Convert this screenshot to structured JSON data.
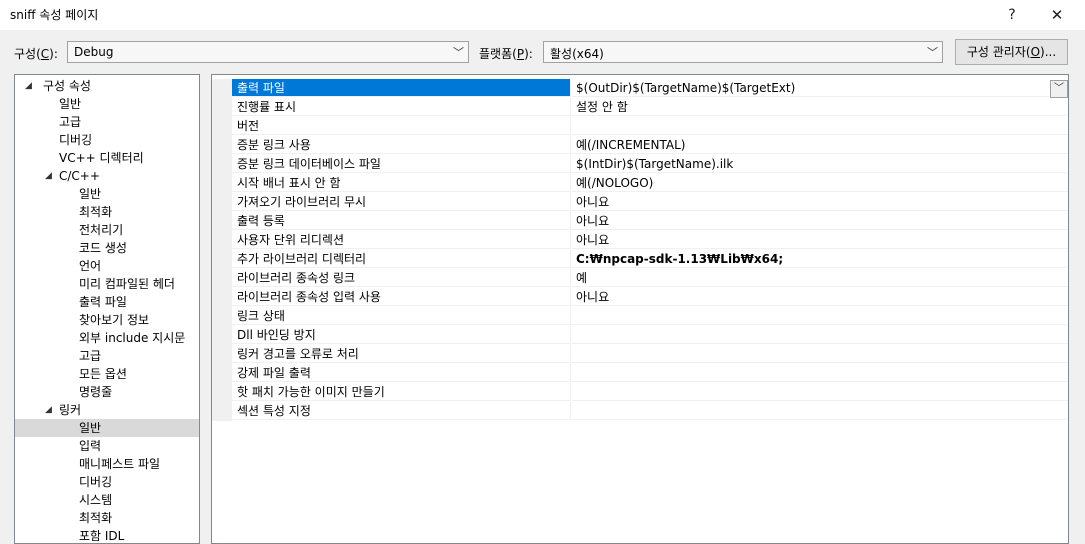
{
  "window": {
    "title": "sniff 속성 페이지",
    "help_glyph": "?",
    "close_glyph": "✕"
  },
  "toolbar": {
    "config_label_prefix": "구성(",
    "config_label_key": "C",
    "config_label_suffix": "):",
    "config_value": "Debug",
    "platform_label_prefix": "플랫폼(",
    "platform_label_key": "P",
    "platform_label_suffix": "):",
    "platform_value": "활성(x64)",
    "config_manager_prefix": "구성 관리자(",
    "config_manager_key": "O",
    "config_manager_suffix": ")..."
  },
  "tree": [
    {
      "label": "구성 속성",
      "level": 0,
      "expander": "◢"
    },
    {
      "label": "일반",
      "level": 1
    },
    {
      "label": "고급",
      "level": 1
    },
    {
      "label": "디버깅",
      "level": 1
    },
    {
      "label": "VC++ 디렉터리",
      "level": 1
    },
    {
      "label": "C/C++",
      "level": 1,
      "expander": "◢"
    },
    {
      "label": "일반",
      "level": 2
    },
    {
      "label": "최적화",
      "level": 2
    },
    {
      "label": "전처리기",
      "level": 2
    },
    {
      "label": "코드 생성",
      "level": 2
    },
    {
      "label": "언어",
      "level": 2
    },
    {
      "label": "미리 컴파일된 헤더",
      "level": 2
    },
    {
      "label": "출력 파일",
      "level": 2
    },
    {
      "label": "찾아보기 정보",
      "level": 2
    },
    {
      "label": "외부 include 지시문",
      "level": 2
    },
    {
      "label": "고급",
      "level": 2
    },
    {
      "label": "모든 옵션",
      "level": 2
    },
    {
      "label": "명령줄",
      "level": 2
    },
    {
      "label": "링커",
      "level": 1,
      "expander": "◢"
    },
    {
      "label": "일반",
      "level": 2,
      "selected": true
    },
    {
      "label": "입력",
      "level": 2
    },
    {
      "label": "매니페스트 파일",
      "level": 2
    },
    {
      "label": "디버깅",
      "level": 2
    },
    {
      "label": "시스템",
      "level": 2
    },
    {
      "label": "최적화",
      "level": 2
    },
    {
      "label": "포함 IDL",
      "level": 2
    }
  ],
  "properties": [
    {
      "name": "출력 파일",
      "value": "$(OutDir)$(TargetName)$(TargetExt)",
      "selected": true
    },
    {
      "name": "진행률 표시",
      "value": "설정 안 함"
    },
    {
      "name": "버전",
      "value": ""
    },
    {
      "name": "증분 링크 사용",
      "value": "예(/INCREMENTAL)"
    },
    {
      "name": "증분 링크 데이터베이스 파일",
      "value": "$(IntDir)$(TargetName).ilk"
    },
    {
      "name": "시작 배너 표시 안 함",
      "value": "예(/NOLOGO)"
    },
    {
      "name": "가져오기 라이브러리 무시",
      "value": "아니요"
    },
    {
      "name": "출력 등록",
      "value": "아니요"
    },
    {
      "name": "사용자 단위 리디렉션",
      "value": "아니요"
    },
    {
      "name": "추가 라이브러리 디렉터리",
      "value": "C:₩npcap-sdk-1.13₩Lib₩x64;",
      "bold": true
    },
    {
      "name": "라이브러리 종속성 링크",
      "value": "예"
    },
    {
      "name": "라이브러리 종속성 입력 사용",
      "value": "아니요"
    },
    {
      "name": "링크 상태",
      "value": ""
    },
    {
      "name": "Dll 바인딩 방지",
      "value": ""
    },
    {
      "name": "링커 경고를 오류로 처리",
      "value": ""
    },
    {
      "name": "강제 파일 출력",
      "value": ""
    },
    {
      "name": "핫 패치 가능한 이미지 만들기",
      "value": ""
    },
    {
      "name": "섹션 특성 지정",
      "value": ""
    }
  ],
  "colors": {
    "selection": "#0078d7",
    "tree_selection": "#d9d9d9"
  }
}
